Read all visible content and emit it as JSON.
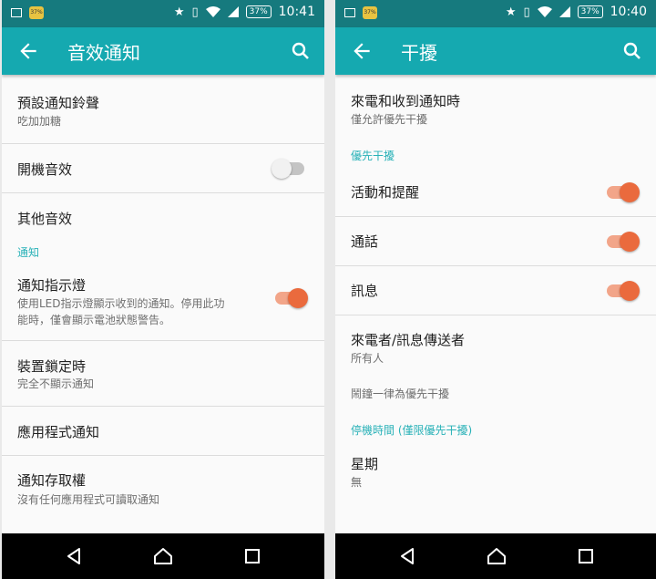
{
  "left": {
    "status": {
      "battery": "37%",
      "time": "10:41",
      "badge": "37%"
    },
    "appbar": {
      "title": "音效通知"
    },
    "rows": {
      "default_tone": {
        "title": "預設通知鈴聲",
        "summary": "吃加加糖"
      },
      "boot_sound": {
        "title": "開機音效",
        "toggle": "off"
      },
      "other_sounds": {
        "title": "其他音效"
      },
      "section_notify": "通知",
      "led": {
        "title": "通知指示燈",
        "summary_line1": "使用LED指示燈顯示收到的通知。停用此功",
        "summary_line2": "能時，僅會顯示電池狀態警告。",
        "toggle": "on"
      },
      "lock_screen": {
        "title": "裝置鎖定時",
        "summary": "完全不顯示通知"
      },
      "app_notify": {
        "title": "應用程式通知"
      },
      "access": {
        "title": "通知存取權",
        "summary": "沒有任何應用程式可讀取通知"
      }
    }
  },
  "right": {
    "status": {
      "battery": "37%",
      "time": "10:40",
      "badge": "37%"
    },
    "appbar": {
      "title": "干擾"
    },
    "rows": {
      "when_calls": {
        "title": "來電和收到通知時",
        "summary": "僅允許優先干擾"
      },
      "section_priority": "優先干擾",
      "events": {
        "title": "活動和提醒",
        "toggle": "on"
      },
      "calls": {
        "title": "通話",
        "toggle": "on"
      },
      "messages": {
        "title": "訊息",
        "toggle": "on"
      },
      "senders": {
        "title": "來電者/訊息傳送者",
        "summary": "所有人"
      },
      "alarms": {
        "text": "鬧鐘一律為優先干擾"
      },
      "section_downtime": "停機時間 (僅限優先干擾)",
      "days": {
        "title": "星期",
        "summary": "無"
      }
    }
  },
  "icons": {
    "back": "arrow-back-icon",
    "search": "search-icon",
    "nav_back": "triangle-back-icon",
    "nav_home": "home-icon",
    "nav_recents": "square-recents-icon"
  },
  "colors": {
    "status_bar": "#167a7e",
    "app_bar": "#15a9b0",
    "accent": "#ea6a3d",
    "section_header": "#2ab2b8"
  }
}
